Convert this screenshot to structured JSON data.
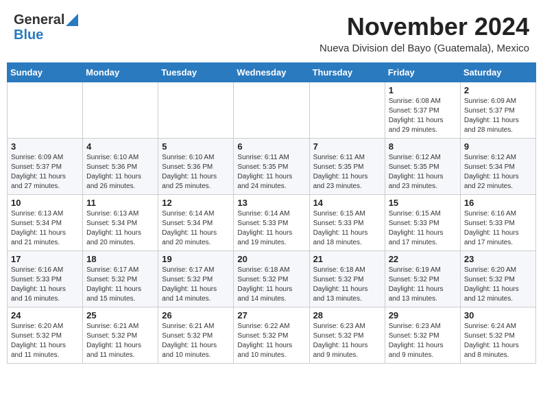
{
  "header": {
    "logo_general": "General",
    "logo_blue": "Blue",
    "month_title": "November 2024",
    "subtitle": "Nueva Division del Bayo (Guatemala), Mexico"
  },
  "days_of_week": [
    "Sunday",
    "Monday",
    "Tuesday",
    "Wednesday",
    "Thursday",
    "Friday",
    "Saturday"
  ],
  "weeks": [
    [
      {
        "day": "",
        "text": ""
      },
      {
        "day": "",
        "text": ""
      },
      {
        "day": "",
        "text": ""
      },
      {
        "day": "",
        "text": ""
      },
      {
        "day": "",
        "text": ""
      },
      {
        "day": "1",
        "text": "Sunrise: 6:08 AM\nSunset: 5:37 PM\nDaylight: 11 hours and 29 minutes."
      },
      {
        "day": "2",
        "text": "Sunrise: 6:09 AM\nSunset: 5:37 PM\nDaylight: 11 hours and 28 minutes."
      }
    ],
    [
      {
        "day": "3",
        "text": "Sunrise: 6:09 AM\nSunset: 5:37 PM\nDaylight: 11 hours and 27 minutes."
      },
      {
        "day": "4",
        "text": "Sunrise: 6:10 AM\nSunset: 5:36 PM\nDaylight: 11 hours and 26 minutes."
      },
      {
        "day": "5",
        "text": "Sunrise: 6:10 AM\nSunset: 5:36 PM\nDaylight: 11 hours and 25 minutes."
      },
      {
        "day": "6",
        "text": "Sunrise: 6:11 AM\nSunset: 5:35 PM\nDaylight: 11 hours and 24 minutes."
      },
      {
        "day": "7",
        "text": "Sunrise: 6:11 AM\nSunset: 5:35 PM\nDaylight: 11 hours and 23 minutes."
      },
      {
        "day": "8",
        "text": "Sunrise: 6:12 AM\nSunset: 5:35 PM\nDaylight: 11 hours and 23 minutes."
      },
      {
        "day": "9",
        "text": "Sunrise: 6:12 AM\nSunset: 5:34 PM\nDaylight: 11 hours and 22 minutes."
      }
    ],
    [
      {
        "day": "10",
        "text": "Sunrise: 6:13 AM\nSunset: 5:34 PM\nDaylight: 11 hours and 21 minutes."
      },
      {
        "day": "11",
        "text": "Sunrise: 6:13 AM\nSunset: 5:34 PM\nDaylight: 11 hours and 20 minutes."
      },
      {
        "day": "12",
        "text": "Sunrise: 6:14 AM\nSunset: 5:34 PM\nDaylight: 11 hours and 20 minutes."
      },
      {
        "day": "13",
        "text": "Sunrise: 6:14 AM\nSunset: 5:33 PM\nDaylight: 11 hours and 19 minutes."
      },
      {
        "day": "14",
        "text": "Sunrise: 6:15 AM\nSunset: 5:33 PM\nDaylight: 11 hours and 18 minutes."
      },
      {
        "day": "15",
        "text": "Sunrise: 6:15 AM\nSunset: 5:33 PM\nDaylight: 11 hours and 17 minutes."
      },
      {
        "day": "16",
        "text": "Sunrise: 6:16 AM\nSunset: 5:33 PM\nDaylight: 11 hours and 17 minutes."
      }
    ],
    [
      {
        "day": "17",
        "text": "Sunrise: 6:16 AM\nSunset: 5:33 PM\nDaylight: 11 hours and 16 minutes."
      },
      {
        "day": "18",
        "text": "Sunrise: 6:17 AM\nSunset: 5:32 PM\nDaylight: 11 hours and 15 minutes."
      },
      {
        "day": "19",
        "text": "Sunrise: 6:17 AM\nSunset: 5:32 PM\nDaylight: 11 hours and 14 minutes."
      },
      {
        "day": "20",
        "text": "Sunrise: 6:18 AM\nSunset: 5:32 PM\nDaylight: 11 hours and 14 minutes."
      },
      {
        "day": "21",
        "text": "Sunrise: 6:18 AM\nSunset: 5:32 PM\nDaylight: 11 hours and 13 minutes."
      },
      {
        "day": "22",
        "text": "Sunrise: 6:19 AM\nSunset: 5:32 PM\nDaylight: 11 hours and 13 minutes."
      },
      {
        "day": "23",
        "text": "Sunrise: 6:20 AM\nSunset: 5:32 PM\nDaylight: 11 hours and 12 minutes."
      }
    ],
    [
      {
        "day": "24",
        "text": "Sunrise: 6:20 AM\nSunset: 5:32 PM\nDaylight: 11 hours and 11 minutes."
      },
      {
        "day": "25",
        "text": "Sunrise: 6:21 AM\nSunset: 5:32 PM\nDaylight: 11 hours and 11 minutes."
      },
      {
        "day": "26",
        "text": "Sunrise: 6:21 AM\nSunset: 5:32 PM\nDaylight: 11 hours and 10 minutes."
      },
      {
        "day": "27",
        "text": "Sunrise: 6:22 AM\nSunset: 5:32 PM\nDaylight: 11 hours and 10 minutes."
      },
      {
        "day": "28",
        "text": "Sunrise: 6:23 AM\nSunset: 5:32 PM\nDaylight: 11 hours and 9 minutes."
      },
      {
        "day": "29",
        "text": "Sunrise: 6:23 AM\nSunset: 5:32 PM\nDaylight: 11 hours and 9 minutes."
      },
      {
        "day": "30",
        "text": "Sunrise: 6:24 AM\nSunset: 5:32 PM\nDaylight: 11 hours and 8 minutes."
      }
    ]
  ]
}
